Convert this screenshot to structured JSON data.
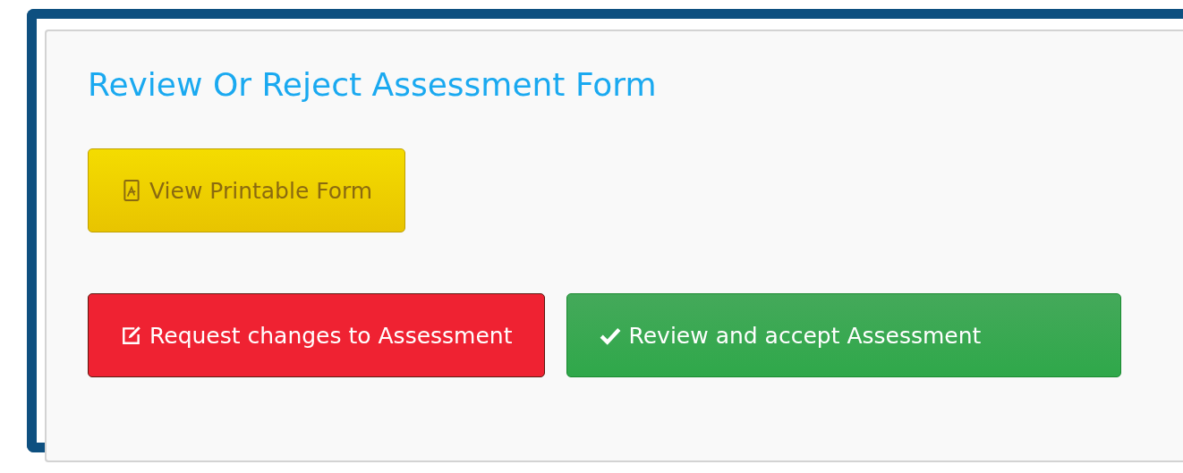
{
  "panel": {
    "title": "Review Or Reject Assessment Form"
  },
  "button_rows": [
    [
      {
        "kind": "printable",
        "label": "View Printable Form"
      }
    ],
    [
      {
        "kind": "request-changes",
        "label": "Request changes to Assessment"
      },
      {
        "kind": "accept",
        "label": "Review and accept Assessment"
      }
    ]
  ]
}
